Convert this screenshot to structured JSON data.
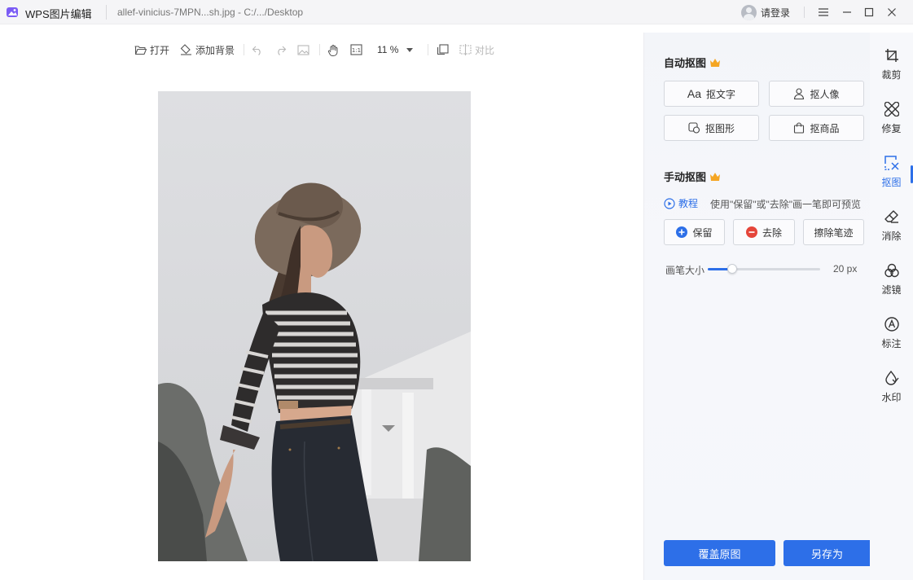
{
  "window": {
    "app_name": "WPS图片编辑",
    "file_name": "allef-vinicius-7MPN...sh.jpg - C:/.../Desktop",
    "login_label": "请登录"
  },
  "toolbar": {
    "open_label": "打开",
    "add_bg_label": "添加背景",
    "zoom_value": "11 %",
    "compare_label": "对比"
  },
  "panel": {
    "auto_title": "自动抠图",
    "auto_buttons": [
      "抠文字",
      "抠人像",
      "抠图形",
      "抠商品"
    ],
    "text_btn_prefix": "Aa",
    "manual_title": "手动抠图",
    "tutorial_label": "教程",
    "hint": "使用\"保留\"或\"去除\"画一笔即可预览",
    "keep_label": "保留",
    "remove_label": "去除",
    "erase_label": "擦除笔迹",
    "brush_label": "画笔大小",
    "brush_value": "20 px",
    "brush_fraction": 0.22,
    "overwrite_label": "覆盖原图",
    "save_as_label": "另存为"
  },
  "side_tools": [
    {
      "label": "裁剪",
      "icon": "crop-icon"
    },
    {
      "label": "修复",
      "icon": "repair-icon"
    },
    {
      "label": "抠图",
      "icon": "cutout-icon"
    },
    {
      "label": "消除",
      "icon": "eraser-icon"
    },
    {
      "label": "滤镜",
      "icon": "filter-icon"
    },
    {
      "label": "标注",
      "icon": "annotate-icon"
    },
    {
      "label": "水印",
      "icon": "watermark-icon"
    }
  ],
  "colors": {
    "accent": "#2d6fe8",
    "crown": "#f5a623",
    "remove_red": "#e5453a"
  }
}
